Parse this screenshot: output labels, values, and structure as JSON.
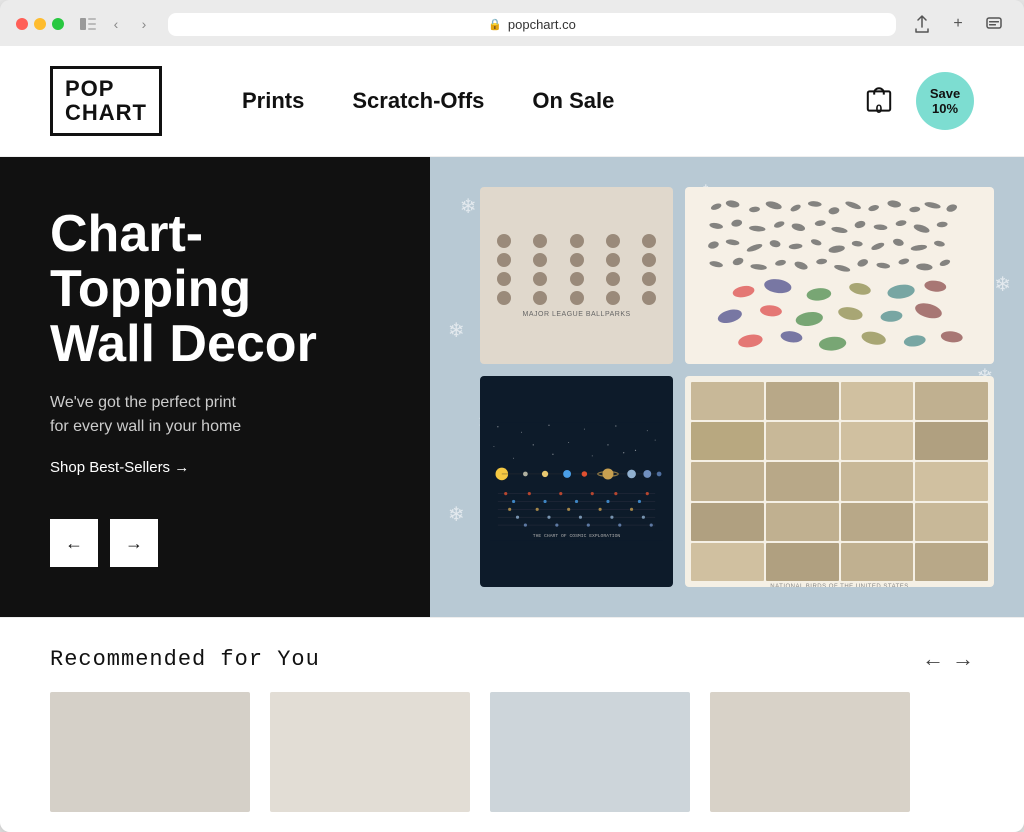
{
  "browser": {
    "url": "popchart.co",
    "back_title": "Back",
    "forward_title": "Forward"
  },
  "header": {
    "logo_line1": "POP",
    "logo_line2": "CHART",
    "nav_items": [
      {
        "label": "Prints",
        "id": "prints"
      },
      {
        "label": "Scratch-Offs",
        "id": "scratch-offs"
      },
      {
        "label": "On Sale",
        "id": "on-sale"
      }
    ],
    "cart_count": "0",
    "save_badge_line1": "Save",
    "save_badge_line2": "10%"
  },
  "hero": {
    "title": "Chart-\nTopping\nWall Decor",
    "subtitle": "We've got the perfect print\nfor every wall in your home",
    "cta_label": "Shop Best-Sellers →",
    "prev_label": "←",
    "next_label": "→"
  },
  "recommended": {
    "title": "Recommended for You",
    "prev_arrow": "←",
    "next_arrow": "→"
  },
  "snowflake_symbol": "❄",
  "colors": {
    "hero_bg_dark": "#111111",
    "hero_bg_light": "#b8c9d4",
    "save_badge": "#7dddd1",
    "cosmic_bg": "#0d1b2a",
    "logo_border": "#111111"
  }
}
